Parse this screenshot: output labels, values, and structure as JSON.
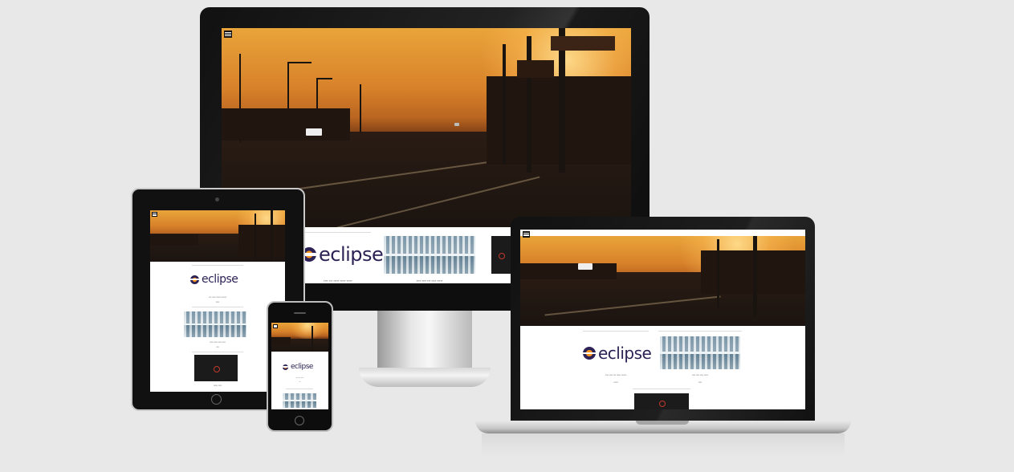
{
  "page": {
    "background": "#e8e8e8",
    "description_devices": [
      "desktop-monitor",
      "tablet",
      "phone",
      "laptop"
    ]
  },
  "site": {
    "brand_logo_text": "eclipse",
    "nav_menu_icon": "hamburger-icon",
    "posts": [
      {
        "thumbnail": "eclipse-logo"
      },
      {
        "thumbnail": "library-aisle-photo"
      },
      {
        "thumbnail": "dark-product-photo"
      }
    ]
  },
  "colors": {
    "sunset_orange": "#d8822a",
    "eclipse_purple": "#2c2255",
    "eclipse_orange": "#f7941e",
    "device_black": "#111111"
  }
}
